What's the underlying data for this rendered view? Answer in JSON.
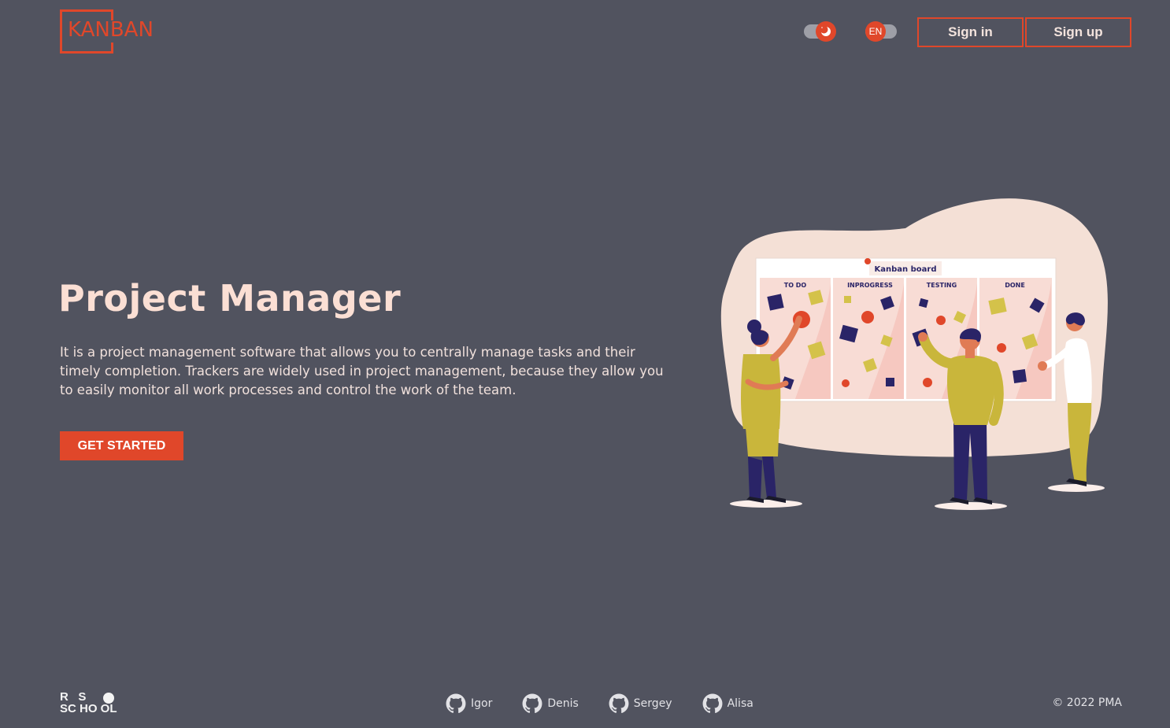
{
  "header": {
    "logo_text": "KANBAN",
    "theme_toggle_icon": "moon-icon",
    "lang_label": "EN",
    "sign_in_label": "Sign in",
    "sign_up_label": "Sign up"
  },
  "hero": {
    "title": "Project Manager",
    "description": "It is a project management software that allows you to centrally manage tasks and their timely completion. Trackers are widely used in project management, because they allow you to easily monitor all work processes and control the work of the team.",
    "cta_label": "GET STARTED"
  },
  "illustration": {
    "board_title": "Kanban board",
    "columns": [
      "TO DO",
      "INPROGRESS",
      "TESTING",
      "DONE"
    ]
  },
  "footer": {
    "school_logo_row1": "R   S",
    "school_logo_row2": "SC HO OL",
    "authors": [
      {
        "name": "Igor",
        "icon": "github-icon"
      },
      {
        "name": "Denis",
        "icon": "github-icon"
      },
      {
        "name": "Sergey",
        "icon": "github-icon"
      },
      {
        "name": "Alisa",
        "icon": "github-icon"
      }
    ],
    "copyright": "© 2022 PMA"
  },
  "colors": {
    "background": "#51535f",
    "accent": "#e0472a",
    "title": "#fbdfd4"
  }
}
